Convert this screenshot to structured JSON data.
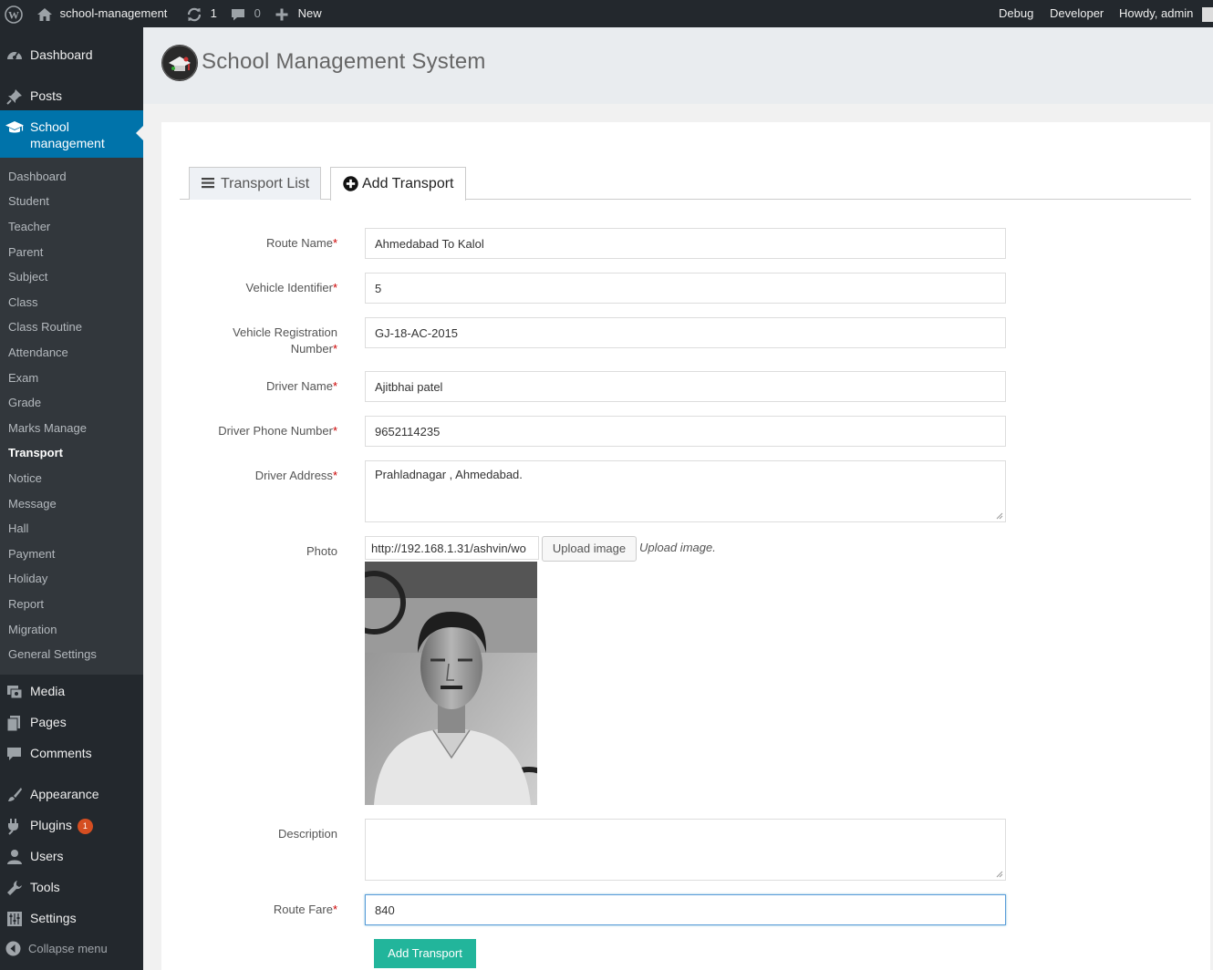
{
  "adminbar": {
    "site_name": "school-management",
    "updates_count": "1",
    "comments_count": "0",
    "new_label": "New",
    "debug_label": "Debug",
    "developer_label": "Developer",
    "howdy_label": "Howdy, admin"
  },
  "sidebar": {
    "dashboard": "Dashboard",
    "posts": "Posts",
    "school_management": "School management",
    "submenu": [
      "Dashboard",
      "Student",
      "Teacher",
      "Parent",
      "Subject",
      "Class",
      "Class Routine",
      "Attendance",
      "Exam",
      "Grade",
      "Marks Manage",
      "Transport",
      "Notice",
      "Message",
      "Hall",
      "Payment",
      "Holiday",
      "Report",
      "Migration",
      "General Settings"
    ],
    "current_submenu": "Transport",
    "media": "Media",
    "pages": "Pages",
    "comments": "Comments",
    "appearance": "Appearance",
    "plugins": "Plugins",
    "plugins_badge": "1",
    "users": "Users",
    "tools": "Tools",
    "settings": "Settings",
    "collapse": "Collapse menu"
  },
  "header": {
    "title": "School Management System"
  },
  "tabs": [
    {
      "label": "Transport List",
      "active": false
    },
    {
      "label": "Add Transport",
      "active": true
    }
  ],
  "form": {
    "route_name": {
      "label": "Route Name",
      "value": "Ahmedabad To Kalol"
    },
    "vehicle_identifier": {
      "label": "Vehicle Identifier",
      "value": "5"
    },
    "vehicle_registration": {
      "label_line1": "Vehicle Registration",
      "label_line2": "Number",
      "value": "GJ-18-AC-2015"
    },
    "driver_name": {
      "label": "Driver Name",
      "value": "Ajitbhai patel"
    },
    "driver_phone": {
      "label": "Driver Phone Number",
      "value": "9652114235"
    },
    "driver_address": {
      "label": "Driver Address",
      "value": "Prahladnagar , Ahmedabad."
    },
    "photo": {
      "label": "Photo",
      "url_value": "http://192.168.1.31/ashvin/wo",
      "upload_button": "Upload image",
      "upload_hint": "Upload image."
    },
    "description": {
      "label": "Description",
      "value": ""
    },
    "route_fare": {
      "label": "Route Fare",
      "value": "840"
    },
    "required_mark": "*",
    "submit_label": "Add Transport"
  },
  "colors": {
    "admin_dark": "#23282d",
    "submenu_bg": "#32373c",
    "primary_blue": "#0073aa",
    "submit_green": "#22b59b",
    "required_red": "#cc0000",
    "badge_orange": "#d54e21"
  }
}
